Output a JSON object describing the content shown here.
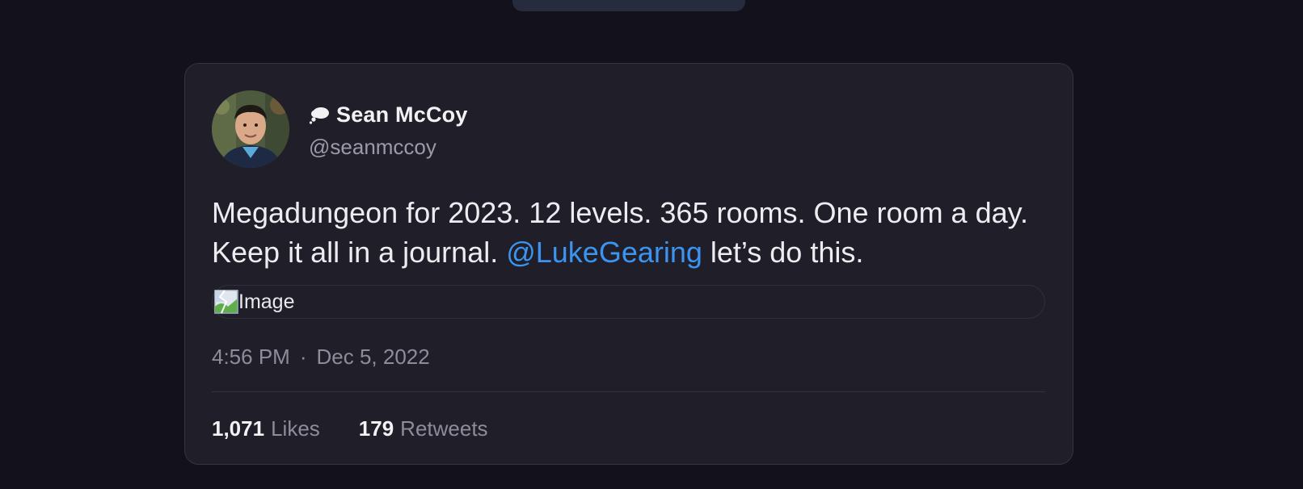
{
  "tweet": {
    "author": {
      "display_name": "Sean McCoy",
      "handle": "@seanmccoy",
      "badge_icon": "thought-bubble-icon",
      "avatar_icon": "profile-photo"
    },
    "text_before": "Megadungeon for 2023. 12 levels. 365 rooms. One room a day. Keep it all in a journal. ",
    "mention": "@LukeGearing",
    "text_after": " let’s do this.",
    "media": {
      "alt": "Image",
      "icon": "broken-image-icon"
    },
    "time": "4:56 PM",
    "separator": "·",
    "date": "Dec 5, 2022",
    "likes": {
      "count": "1,071",
      "label": "Likes"
    },
    "retweets": {
      "count": "179",
      "label": "Retweets"
    }
  },
  "colors": {
    "background": "#13121c",
    "card": "#201f29",
    "mention": "#3b94f0",
    "muted_text": "#8e8c9a"
  }
}
